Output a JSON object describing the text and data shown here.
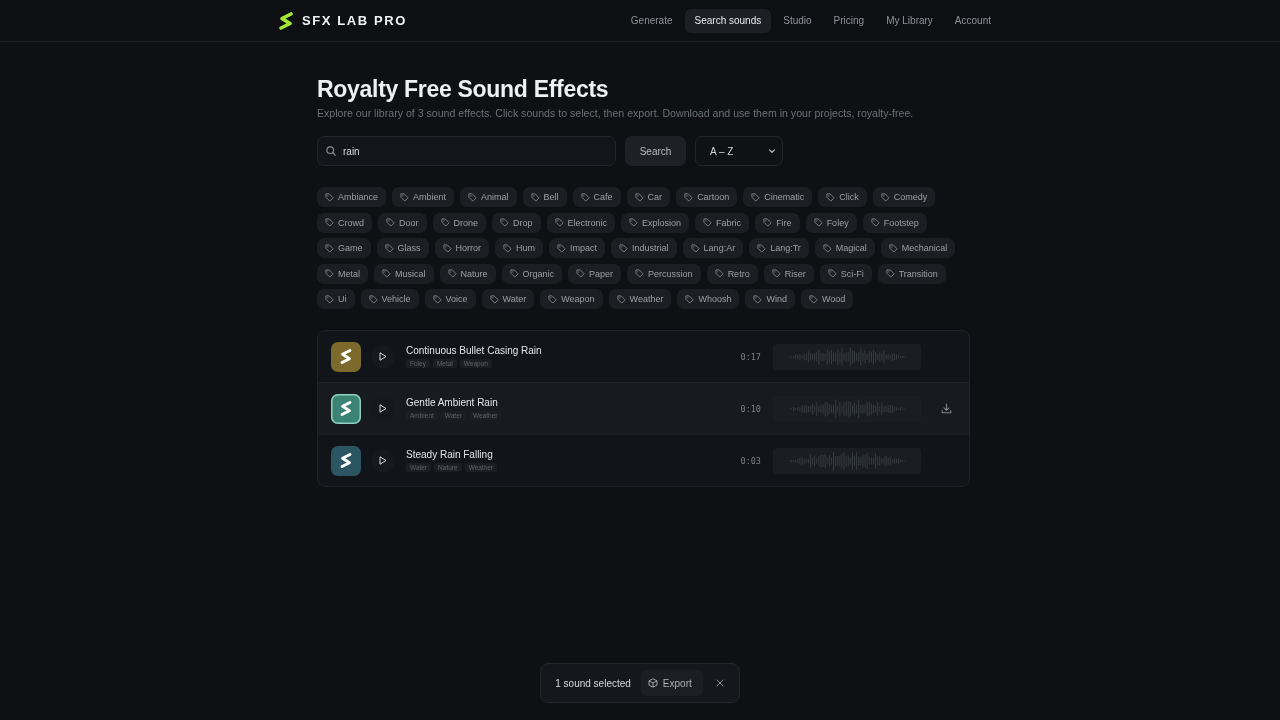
{
  "header": {
    "logo": "SFX LAB PRO",
    "nav": [
      {
        "label": "Generate",
        "selected": false
      },
      {
        "label": "Search sounds",
        "selected": true
      },
      {
        "label": "Studio",
        "selected": false
      },
      {
        "label": "Pricing",
        "selected": false
      },
      {
        "label": "My Library",
        "selected": false
      },
      {
        "label": "Account",
        "selected": false
      }
    ]
  },
  "page": {
    "title": "Royalty Free Sound Effects",
    "subtitle": "Explore our library of 3 sound effects. Click sounds to select, then export. Download and use them in your projects, royalty-free."
  },
  "search": {
    "value": "rain",
    "button": "Search",
    "sort": "A – Z"
  },
  "tags": [
    "Ambiance",
    "Ambient",
    "Animal",
    "Bell",
    "Cafe",
    "Car",
    "Cartoon",
    "Cinematic",
    "Click",
    "Comedy",
    "Crowd",
    "Door",
    "Drone",
    "Drop",
    "Electronic",
    "Explosion",
    "Fabric",
    "Fire",
    "Foley",
    "Footstep",
    "Game",
    "Glass",
    "Horror",
    "Hum",
    "Impact",
    "Industrial",
    "Lang:Ar",
    "Lang:Tr",
    "Magical",
    "Mechanical",
    "Metal",
    "Musical",
    "Nature",
    "Organic",
    "Paper",
    "Percussion",
    "Retro",
    "Riser",
    "Sci-Fi",
    "Transition",
    "Ui",
    "Vehicle",
    "Voice",
    "Water",
    "Weapon",
    "Weather",
    "Whoosh",
    "Wind",
    "Wood"
  ],
  "sounds": [
    {
      "title": "Continuous Bullet Casing Rain",
      "tags": [
        "Foley",
        "Metal",
        "Weapon"
      ],
      "duration": "0:17",
      "color": "#7c6a2c",
      "selected": false
    },
    {
      "title": "Gentle Ambient Rain",
      "tags": [
        "Ambient",
        "Water",
        "Weather"
      ],
      "duration": "0:10",
      "color": "#3b8475",
      "selected": true
    },
    {
      "title": "Steady Rain Falling",
      "tags": [
        "Water",
        "Nature",
        "Weather"
      ],
      "duration": "0:03",
      "color": "#2c5562",
      "selected": false
    }
  ],
  "selection_bar": {
    "text": "1 sound selected",
    "export": "Export"
  }
}
